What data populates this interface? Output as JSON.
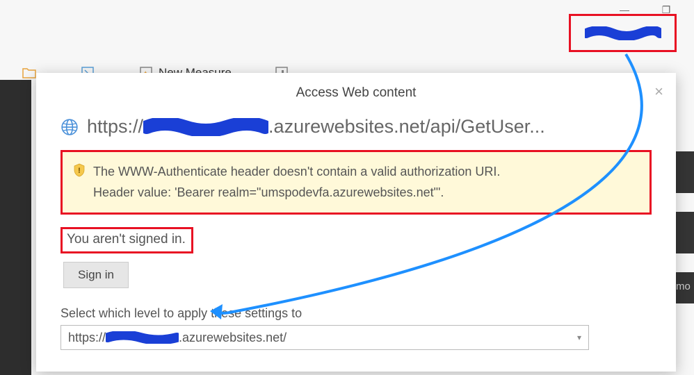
{
  "window": {
    "minimize": "—",
    "maximize": "❐"
  },
  "ribbon": {
    "new_measure": "New Measure"
  },
  "dialog": {
    "title": "Access Web content",
    "close": "×",
    "url_prefix": "https://",
    "url_suffix": ".azurewebsites.net/api/GetUser...",
    "warning_line1": "The WWW-Authenticate header doesn't contain a valid authorization URI.",
    "warning_line2": "Header value: 'Bearer realm=\"umspodevfa.azurewebsites.net\"'.",
    "signed_out_msg": "You aren't signed in.",
    "signin_btn": "Sign in",
    "level_label": "Select which level to apply these settings to",
    "select_prefix": "https://",
    "select_suffix": ".azurewebsites.net/"
  },
  "side": {
    "fragment": "mo"
  }
}
